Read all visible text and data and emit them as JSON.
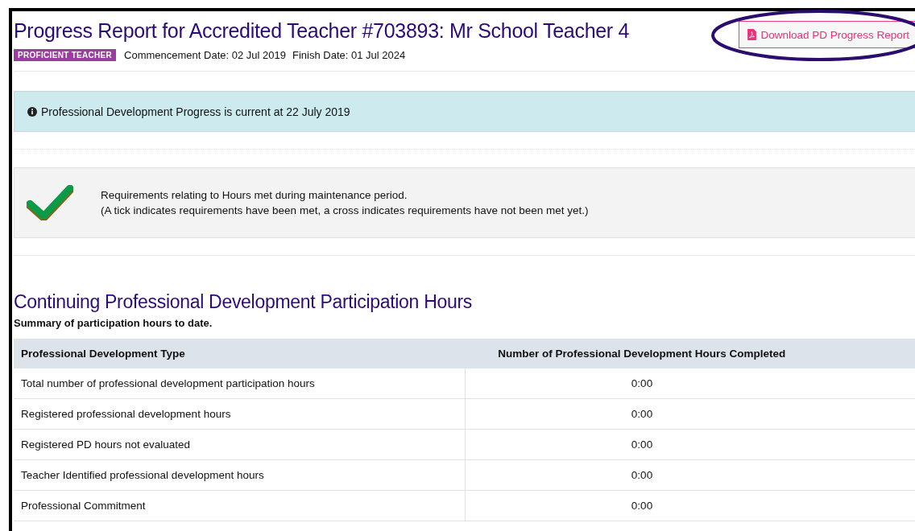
{
  "header": {
    "title": "Progress Report for Accredited Teacher #703893: Mr School Teacher 4",
    "badge": "PROFICIENT TEACHER",
    "commencement": "Commencement Date: 02 Jul 2019",
    "finish": "Finish Date: 01 Jul 2024",
    "download_button": "Download PD Progress Report",
    "button_circled": true
  },
  "info_alert": "Professional Development Progress is current at 22 July 2019",
  "requirement": {
    "met": true,
    "lines": [
      "Requirements relating to Hours met during maintenance period.",
      "(A tick indicates requirements have been met, a cross indicates requirements have not been met yet.)"
    ]
  },
  "section": {
    "title": "Continuing Professional Development Participation Hours",
    "subtitle": "Summary of participation hours to date."
  },
  "table": {
    "columns": [
      "Professional Development Type",
      "Number of Professional Development Hours Completed"
    ],
    "rows": [
      [
        "Total number of professional development participation hours",
        "0:00"
      ],
      [
        "Registered professional development hours",
        "0:00"
      ],
      [
        "Registered PD hours not evaluated",
        "0:00"
      ],
      [
        "Teacher Identified professional development hours",
        "0:00"
      ],
      [
        "Professional Commitment",
        "0:00"
      ]
    ]
  }
}
